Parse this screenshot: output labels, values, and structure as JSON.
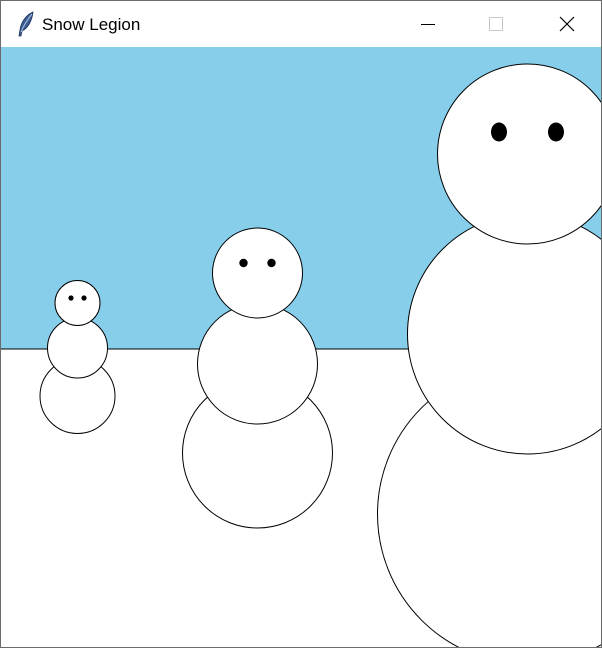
{
  "window": {
    "title": "Snow Legion",
    "app_icon": "feather-icon",
    "controls": {
      "minimize_icon": "minimize-icon",
      "maximize_icon": "maximize-icon",
      "close_icon": "close-icon"
    }
  },
  "scene": {
    "sky_color": "#87CEEB",
    "ground_color": "#FFFFFF",
    "snow_color": "#FFFFFF",
    "outline_color": "#000000",
    "eye_color": "#000000",
    "snowmen_count": 3
  }
}
